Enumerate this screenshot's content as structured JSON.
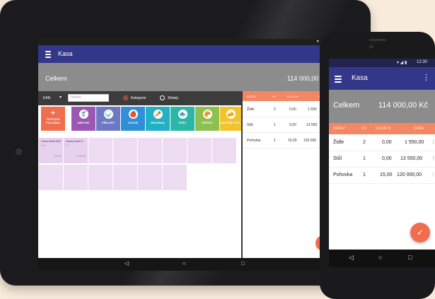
{
  "colors": {
    "appbar": "#33378a",
    "accent": "#f06d4e",
    "table_header": "#f48763",
    "total_bar": "#8c8c8c"
  },
  "tablet": {
    "app_title": "Kasa",
    "total_label": "Celkem",
    "total_value": "114 000,00",
    "toolbar": {
      "ean_label": "EAN",
      "dropdown_icon": "▾",
      "search_placeholder": "Hledat",
      "radio_category": "Kategorie",
      "radio_stock": "Sklady"
    },
    "text_item_button": "TEXTOVÁ POLOŽKA",
    "categories": [
      {
        "label": "NÁPOJE",
        "icon": "drink-icon",
        "color": "#9a57b3"
      },
      {
        "label": "PŘÍLOHY",
        "icon": "side-dish-icon",
        "color": "#6e79c5"
      },
      {
        "label": "OVOCE",
        "icon": "fruit-icon",
        "color": "#2f8fd8"
      },
      {
        "label": "ZELENINA",
        "icon": "vegetable-icon",
        "color": "#23b0c4"
      },
      {
        "label": "RYBY",
        "icon": "fish-icon",
        "color": "#2bb7a8"
      },
      {
        "label": "PEČIVO",
        "icon": "bread-icon",
        "color": "#8ec04f"
      },
      {
        "label": "MLÉČNÉ VÝR.",
        "icon": "dairy-icon",
        "color": "#f3c22f"
      }
    ],
    "items": [
      {
        "name": "Coca-Cola 0,5l",
        "sub": "0,5 l",
        "price": "30 Kč"
      },
      {
        "name": "Coca-Cola 2 l",
        "sub": "2 l",
        "price": "1 100 Kč"
      }
    ],
    "table": {
      "headers": [
        "NÁZEV",
        "KS",
        "SLEVA %",
        "CENA"
      ],
      "rows": [
        {
          "name": "Židle",
          "qty": "2",
          "discount": "0,00",
          "price": "1 550"
        },
        {
          "name": "Stůl",
          "qty": "1",
          "discount": "0,00",
          "price": "13 550"
        },
        {
          "name": "Pohovka",
          "qty": "1",
          "discount": "15,00",
          "price": "120 000"
        }
      ]
    },
    "nav": {
      "back": "◁",
      "home": "○",
      "recent": "□"
    }
  },
  "phone": {
    "status_time": "12:30",
    "app_title": "Kasa",
    "more_icon": "⋮",
    "total_label": "Celkem",
    "total_value": "114 000,00 Kč",
    "table": {
      "headers": [
        "NÁZEV",
        "KS",
        "SLEVA %",
        "CENA"
      ],
      "rows": [
        {
          "name": "Židle",
          "qty": "2",
          "discount": "0,00",
          "price": "1 550,00"
        },
        {
          "name": "Stůl",
          "qty": "1",
          "discount": "0,00",
          "price": "13 550,00"
        },
        {
          "name": "Pohovka",
          "qty": "1",
          "discount": "15,00",
          "price": "120 000,00"
        }
      ]
    },
    "confirm_icon": "✓",
    "row_menu_icon": "⋮",
    "nav": {
      "back": "◁",
      "home": "○",
      "recent": "□"
    }
  }
}
